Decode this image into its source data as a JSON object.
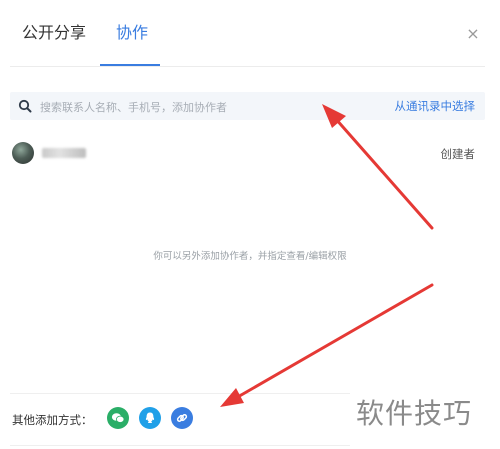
{
  "tabs": [
    {
      "label": "公开分享",
      "active": false
    },
    {
      "label": "协作",
      "active": true
    }
  ],
  "close_symbol": "×",
  "search": {
    "placeholder": "搜索联系人名称、手机号，添加协作者",
    "contact_link": "从通讯录中选择"
  },
  "member": {
    "role": "创建者"
  },
  "hint": "你可以另外添加协作者，并指定查看/编辑权限",
  "other_methods": {
    "label": "其他添加方式：",
    "buttons": [
      {
        "icon": "wechat-icon",
        "color": "#2aae67"
      },
      {
        "icon": "qq-icon",
        "color": "#20a0e8"
      },
      {
        "icon": "link-icon",
        "color": "#3a7de0"
      }
    ]
  },
  "watermark": "软件技巧",
  "colors": {
    "accent": "#3a7de0",
    "annotation_arrow": "#e53935"
  }
}
